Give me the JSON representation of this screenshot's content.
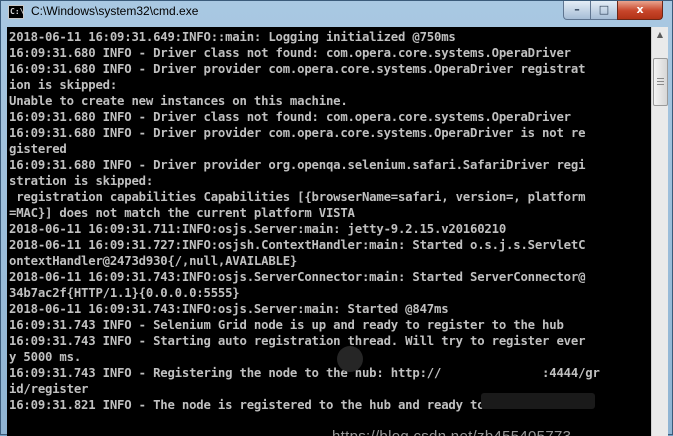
{
  "window": {
    "title": "C:\\Windows\\system32\\cmd.exe",
    "app_icon_text": "C:\\",
    "buttons": {
      "minimize": "–",
      "maximize": "□",
      "close": "x"
    }
  },
  "console": {
    "lines": [
      "2018-06-11 16:09:31.649:INFO::main: Logging initialized @750ms",
      "16:09:31.680 INFO - Driver class not found: com.opera.core.systems.OperaDriver",
      "16:09:31.680 INFO - Driver provider com.opera.core.systems.OperaDriver registrat",
      "ion is skipped:",
      "Unable to create new instances on this machine.",
      "16:09:31.680 INFO - Driver class not found: com.opera.core.systems.OperaDriver",
      "16:09:31.680 INFO - Driver provider com.opera.core.systems.OperaDriver is not re",
      "gistered",
      "16:09:31.680 INFO - Driver provider org.openqa.selenium.safari.SafariDriver regi",
      "stration is skipped:",
      " registration capabilities Capabilities [{browserName=safari, version=, platform",
      "=MAC}] does not match the current platform VISTA",
      "2018-06-11 16:09:31.711:INFO:osjs.Server:main: jetty-9.2.15.v20160210",
      "2018-06-11 16:09:31.727:INFO:osjsh.ContextHandler:main: Started o.s.j.s.ServletC",
      "ontextHandler@2473d930{/,null,AVAILABLE}",
      "2018-06-11 16:09:31.743:INFO:osjs.ServerConnector:main: Started ServerConnector@",
      "34b7ac2f{HTTP/1.1}{0.0.0.0:5555}",
      "2018-06-11 16:09:31.743:INFO:osjs.Server:main: Started @847ms",
      "16:09:31.743 INFO - Selenium Grid node is up and ready to register to the hub",
      "16:09:31.743 INFO - Starting auto registration thread. Will try to register ever",
      "y 5000 ms.",
      "16:09:31.743 INFO - Registering the node to the hub: http://              :4444/gr",
      "id/register",
      "16:09:31.821 INFO - The node is registered to the hub and ready to use"
    ]
  },
  "watermark": "https://blog.csdn.net/zb455405773"
}
